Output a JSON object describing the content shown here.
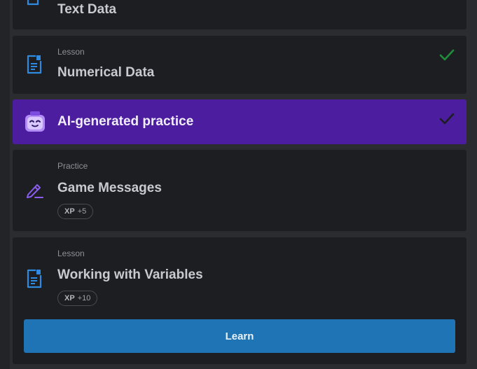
{
  "items": [
    {
      "title": "Text Data"
    },
    {
      "type": "Lesson",
      "title": "Numerical Data",
      "completed": true,
      "icon": "lesson-doc-icon"
    },
    {
      "title": "AI-generated practice",
      "completed": true,
      "icon": "ai-robot-icon",
      "accent": "#4c1d9e"
    },
    {
      "type": "Practice",
      "title": "Game Messages",
      "xp_label": "XP",
      "xp_value": "+5",
      "icon": "pencil-practice-icon"
    },
    {
      "type": "Lesson",
      "title": "Working with Variables",
      "xp_label": "XP",
      "xp_value": "+10",
      "icon": "lesson-doc-icon",
      "button_label": "Learn"
    }
  ],
  "colors": {
    "check_green": "#1f8f3a",
    "learn_button": "#1e74b4",
    "icon_blue": "#2f8ae0",
    "practice_purple": "#8a5cf0"
  }
}
